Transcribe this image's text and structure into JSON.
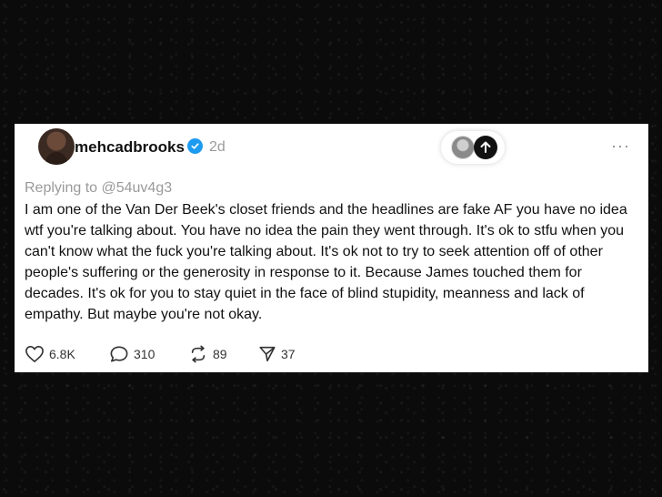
{
  "post": {
    "username": "mehcadbrooks",
    "time": "2d",
    "replying_to": "Replying to @54uv4g3",
    "text": "I am one of the Van Der Beek's closet friends and the headlines are fake AF you have no idea wtf you're talking about. You have no idea the pain they went through. It's ok to stfu when you can't know what the fuck you're talking about. It's ok not to try to seek attention off of other people's suffering or the generosity in response to it. Because James touched them for decades. It's ok for you to stay quiet in the face of blind stupidity, meanness and lack of empathy. But maybe you're not okay.",
    "more_label": "···"
  },
  "actions": {
    "likes": "6.8K",
    "replies": "310",
    "reposts": "89",
    "shares": "37"
  },
  "icons": {
    "verified": "verified-badge-icon",
    "like": "heart-icon",
    "reply": "comment-icon",
    "repost": "repost-icon",
    "share": "send-icon",
    "scroll_up": "arrow-up-icon"
  },
  "colors": {
    "verified": "#1d9bf0",
    "meta": "#9a9a9a",
    "text": "#111111",
    "background": "#0b0b0b",
    "card": "#ffffff"
  }
}
